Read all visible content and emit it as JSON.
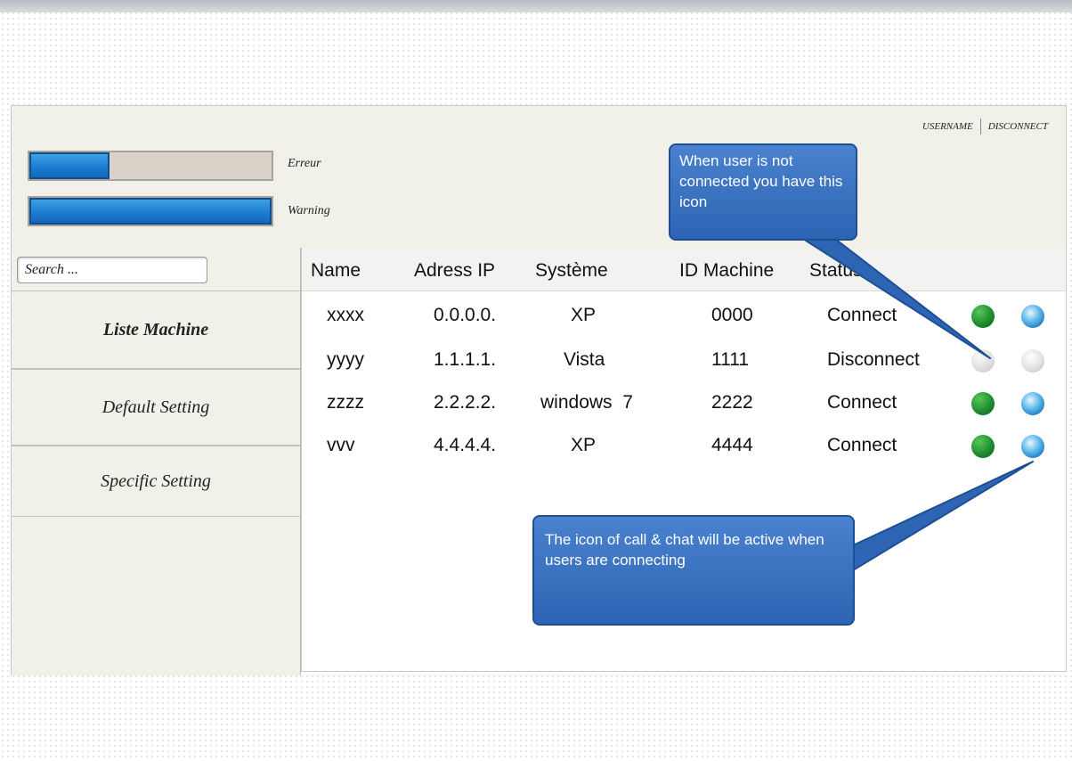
{
  "header": {
    "username_label": "USERNAME",
    "disconnect_label": "DISCONNECT",
    "bars": [
      {
        "label": "Erreur",
        "progress": 0.33
      },
      {
        "label": "Warning",
        "progress": 1.0
      }
    ]
  },
  "sidebar": {
    "search_placeholder": "Search ...",
    "items": [
      {
        "label": "Liste Machine",
        "active": true
      },
      {
        "label": "Default Setting",
        "active": false
      },
      {
        "label": "Specific Setting",
        "active": false
      }
    ]
  },
  "table": {
    "columns": [
      "Name",
      "Adress IP",
      "Système",
      "ID Machine",
      "Status"
    ],
    "rows": [
      {
        "name": "xxxx",
        "ip": "0.0.0.0.",
        "system": "XP",
        "id": "0000",
        "status": "Connect",
        "active": true
      },
      {
        "name": "yyyy",
        "ip": "1.1.1.1.",
        "system": "Vista",
        "id": "1111",
        "status": "Disconnect",
        "active": false
      },
      {
        "name": "zzzz",
        "ip": "2.2.2.2.",
        "system": "windows  7",
        "id": "2222",
        "status": "Connect",
        "active": true
      },
      {
        "name": "vvv",
        "ip": "4.4.4.4.",
        "system": "XP",
        "id": "4444",
        "status": "Connect",
        "active": true
      }
    ]
  },
  "callouts": {
    "top": "When user is not connected you have this icon",
    "bottom": "The icon of call & chat will be active when users are connecting"
  },
  "icons": {
    "call": "phone-call-icon",
    "chat": "chat-globe-icon"
  },
  "colors": {
    "progress_fill": "#1a7ad0",
    "callout_bg": "#3a70c0",
    "call_active": "#1f8f2e",
    "chat_active": "#3aa0e0"
  }
}
